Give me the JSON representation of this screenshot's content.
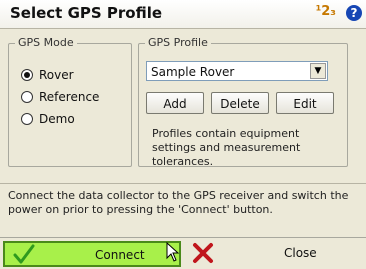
{
  "title": "Select GPS Profile",
  "input_mode": "¹2₃",
  "help_glyph": "?",
  "gps_mode": {
    "legend": "GPS Mode",
    "options": [
      {
        "label": "Rover",
        "selected": true
      },
      {
        "label": "Reference",
        "selected": false
      },
      {
        "label": "Demo",
        "selected": false
      }
    ]
  },
  "gps_profile": {
    "legend": "GPS Profile",
    "selected_value": "Sample Rover",
    "add_label": "Add",
    "delete_label": "Delete",
    "edit_label": "Edit",
    "description": "Profiles contain equipment settings and measurement tolerances."
  },
  "message": "Connect the data collector to the GPS receiver and switch the power on prior to pressing the 'Connect' button.",
  "buttons": {
    "connect_label": "Connect",
    "close_label": "Close"
  },
  "colors": {
    "connect_bg": "#a8f04a",
    "check_green": "#2f9a1e",
    "close_red": "#c0161c",
    "help_blue": "#1646b4"
  },
  "icons": {
    "connect": "checkmark-icon",
    "close": "red-x-icon",
    "help": "help-icon",
    "cursor": "mouse-pointer-icon"
  }
}
